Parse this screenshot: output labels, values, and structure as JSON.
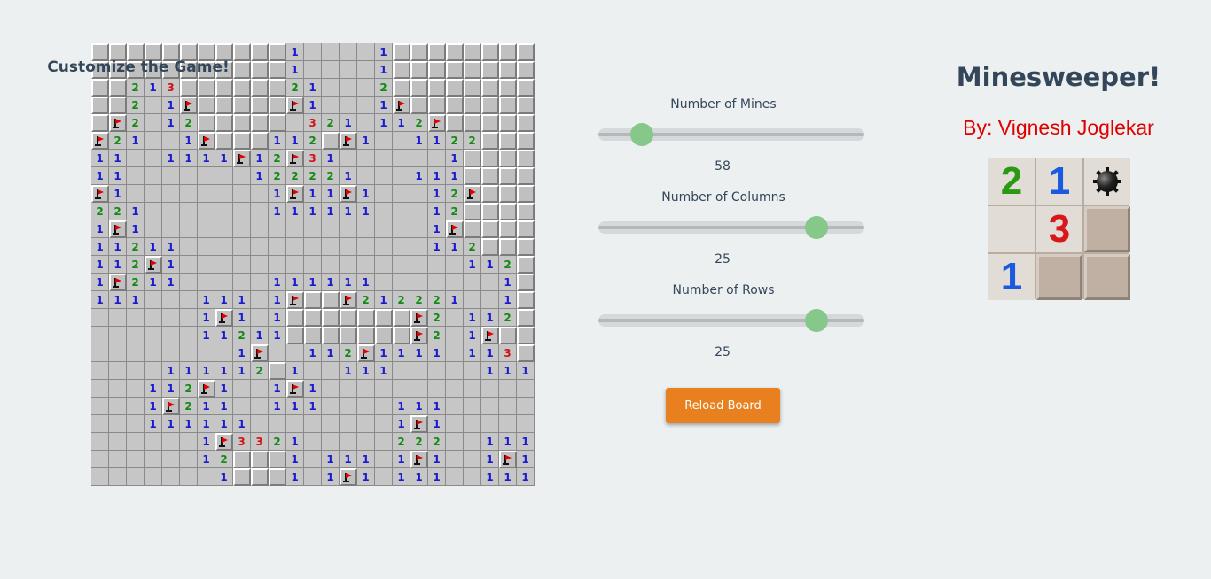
{
  "board": {
    "rows": [
      "HHHHHHHHHHH1OOOO1HHHHHHHH",
      "HHHHHHHHHHH1OOOO1HHHHHHHH",
      "HH213HHHHHH21OOO2HHHHHHHH",
      "HH2O1FHHHHHF1OOO1FHHHHHHH",
      "HF2O12HHHHHO321O112FHHHHH",
      "F21OO1FHHH112HF1OO1122HHH",
      "11OO1111F12F31OOOOOO1HHHH",
      "11OOOOOOO122221OOO111HHHH",
      "F1OOOOOOOO1F11F1OOO12FHHH",
      "221OOOOOOO111111OOO12HHHH",
      "1F1OOOOOOOOOOOOOOOO1FHHHH",
      "11211OOOOOOOOOOOOOO112HHH",
      "112F1OOOOOOOOOOOOOOOO112H",
      "1F211OOOOO111111OOOOOOO1H",
      "111OOO111O1FHHF212221OO1H",
      "OOOOOO1F1O1HHHHHHHF2O112H",
      "OOOOOO11211HHHHHHHF2O1FHH",
      "OOOOOOOO1FOO112F1111O113H",
      "OOOO111112H1OO111OOOOO111",
      "OOO112F1OO1F1OOOOOOOOOOOO",
      "OOO1F211OO111OOOO111OOOOO",
      "OOO111111OOOOOOOO1F1OOOOO",
      "OOOOOO1F3321OOOOO222OO111",
      "OOOOOO12HHH1O111O1F1OO1F1",
      "OOOOOOO1HHH1O1F1O111OO111"
    ]
  },
  "settings": {
    "title": "Customize the Game!",
    "mines": {
      "label": "Number of Mines",
      "value": "58",
      "fraction": 0.13
    },
    "columns": {
      "label": "Number of Columns",
      "value": "25",
      "fraction": 0.85
    },
    "rows": {
      "label": "Number of Rows",
      "value": "25",
      "fraction": 0.85
    },
    "reload_label": "Reload Board"
  },
  "header": {
    "title": "Minesweeper!",
    "author": "By: Vignesh Joglekar"
  },
  "logo": {
    "tiles": [
      "2",
      "1",
      "mine",
      "",
      "3",
      "closed",
      "1",
      "closed",
      "closed"
    ]
  },
  "colors": {
    "accent": "#e8801f",
    "slider_thumb": "#86c78a",
    "title": "#34475a",
    "author": "#e00000",
    "num1": "#1a1ad0",
    "num2": "#148a14",
    "num3": "#d01414"
  }
}
